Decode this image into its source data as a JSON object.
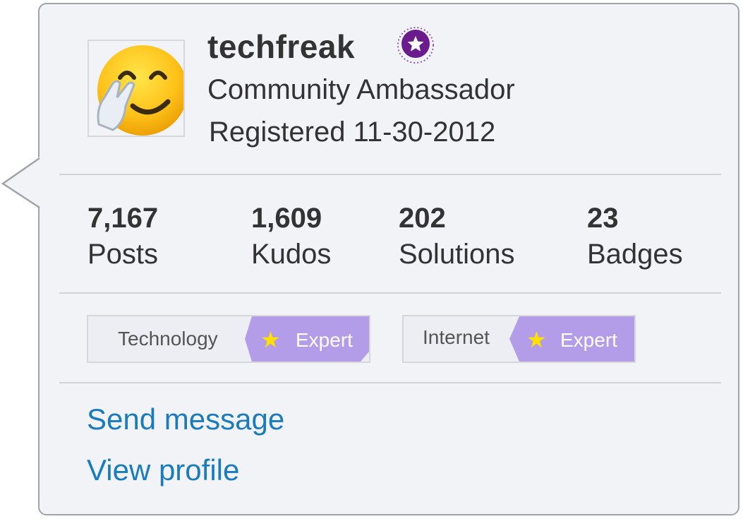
{
  "profile": {
    "username": "techfreak",
    "rank": "Community Ambassador",
    "registered": "Registered 11-30-2012",
    "avatar": "smiling-face-fingers-crossed",
    "rank_icon": "star-rank-icon"
  },
  "stats": [
    {
      "value": "7,167",
      "label": "Posts"
    },
    {
      "value": "1,609",
      "label": "Kudos"
    },
    {
      "value": "202",
      "label": "Solutions"
    },
    {
      "value": "23",
      "label": "Badges"
    }
  ],
  "badges": [
    {
      "board": "Technology",
      "level": "Expert",
      "icon": "star-icon"
    },
    {
      "board": "Internet",
      "level": "Expert",
      "icon": "star-icon"
    }
  ],
  "actions": {
    "send_message": "Send message",
    "view_profile": "View profile"
  },
  "colors": {
    "card_background": "#f1f3f6",
    "card_border": "#9fa4a9",
    "link": "#1a7bbd",
    "rank_purple": "#6a1b8c",
    "expert_tag": "#b39ce8",
    "star": "#ffe000"
  }
}
